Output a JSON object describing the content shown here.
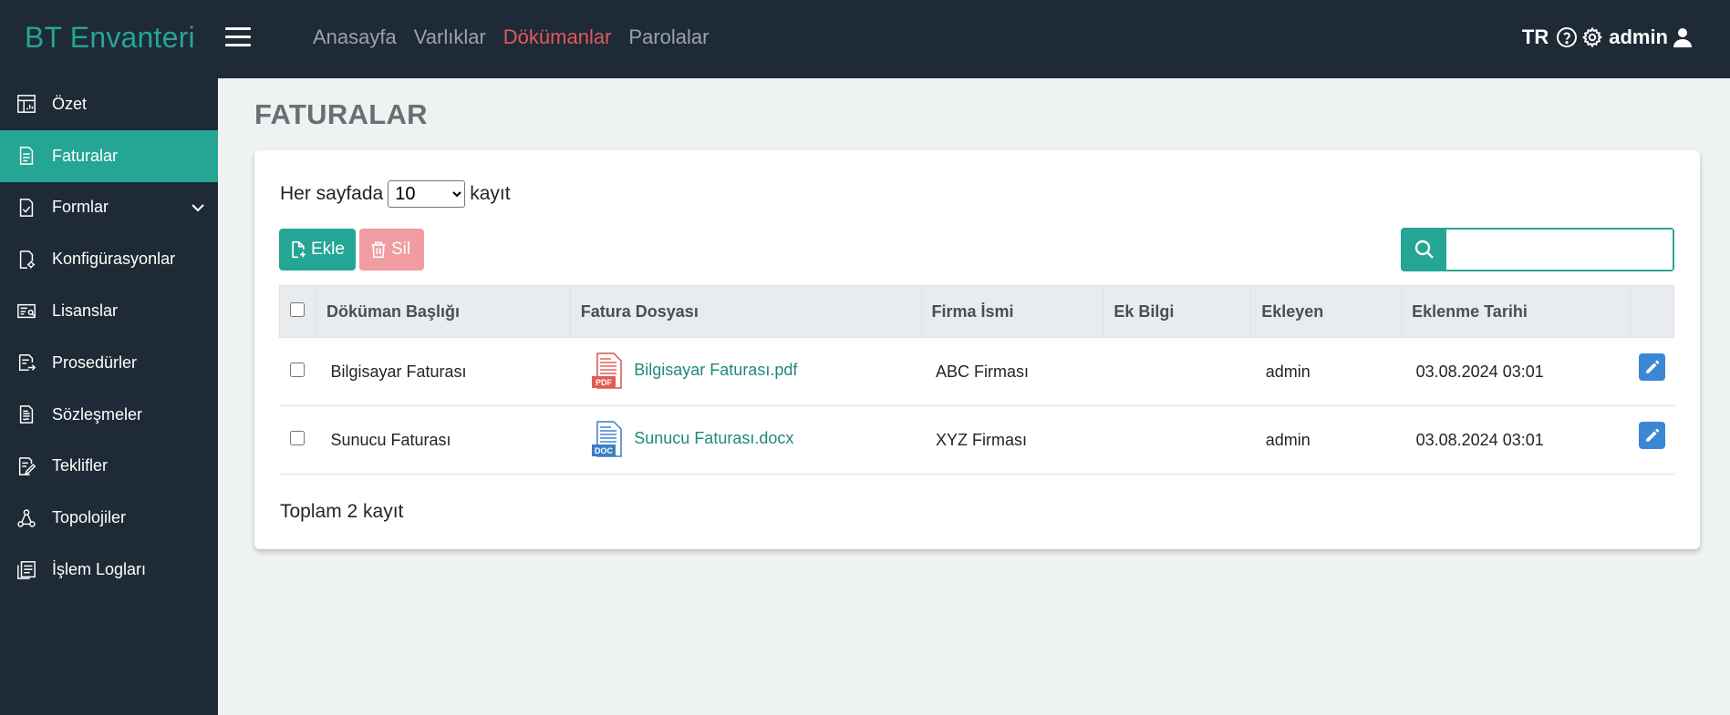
{
  "app": {
    "brand": "BT Envanteri",
    "accent_color": "#25a594",
    "header_bg": "#1e2a35",
    "active_nav_color": "#e05a5f"
  },
  "topnav": {
    "items": [
      {
        "label": "Anasayfa",
        "active": false
      },
      {
        "label": "Varlıklar",
        "active": false
      },
      {
        "label": "Dökümanlar",
        "active": true
      },
      {
        "label": "Parolalar",
        "active": false
      }
    ]
  },
  "user": {
    "lang": "TR",
    "name": "admin",
    "icons": [
      "help-icon",
      "gear-icon",
      "user-icon"
    ]
  },
  "sidebar": {
    "items": [
      {
        "label": "Özet",
        "icon": "dashboard-icon",
        "active": false
      },
      {
        "label": "Faturalar",
        "icon": "invoice-icon",
        "active": true
      },
      {
        "label": "Formlar",
        "icon": "form-check-icon",
        "active": false,
        "expandable": true
      },
      {
        "label": "Konfigürasyonlar",
        "icon": "config-file-icon",
        "active": false
      },
      {
        "label": "Lisanslar",
        "icon": "license-icon",
        "active": false
      },
      {
        "label": "Prosedürler",
        "icon": "procedure-icon",
        "active": false
      },
      {
        "label": "Sözleşmeler",
        "icon": "contract-icon",
        "active": false
      },
      {
        "label": "Teklifler",
        "icon": "offer-icon",
        "active": false
      },
      {
        "label": "Topolojiler",
        "icon": "topology-icon",
        "active": false
      },
      {
        "label": "İşlem Logları",
        "icon": "log-icon",
        "active": false
      }
    ]
  },
  "page": {
    "title": "FATURALAR",
    "perpage_prefix": "Her sayfada",
    "perpage_value": "10",
    "perpage_suffix": "kayıt",
    "add_label": "Ekle",
    "delete_label": "Sil",
    "search_placeholder": "",
    "total_text": "Toplam 2 kayıt"
  },
  "table": {
    "columns": [
      "Döküman Başlığı",
      "Fatura Dosyası",
      "Firma İsmi",
      "Ek Bilgi",
      "Ekleyen",
      "Eklenme Tarihi"
    ],
    "rows": [
      {
        "title": "Bilgisayar Faturası",
        "file": "Bilgisayar Faturası.pdf",
        "file_type": "PDF",
        "company": "ABC Firması",
        "extra": "",
        "added_by": "admin",
        "date": "03.08.2024 03:01"
      },
      {
        "title": "Sunucu Faturası",
        "file": "Sunucu Faturası.docx",
        "file_type": "DOC",
        "company": "XYZ Firması",
        "extra": "",
        "added_by": "admin",
        "date": "03.08.2024 03:01"
      }
    ]
  }
}
